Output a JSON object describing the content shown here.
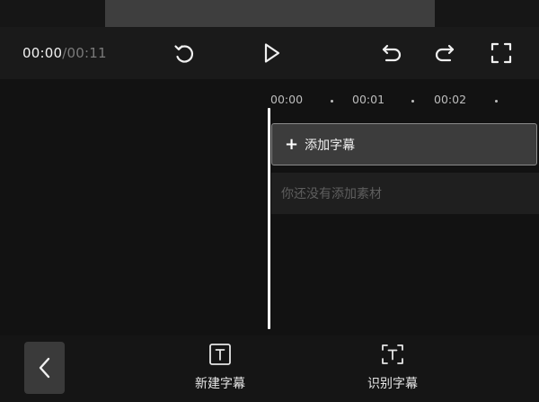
{
  "player": {
    "current_time": "00:00",
    "separator_total": "/00:11"
  },
  "timeline": {
    "ruler": [
      "00:00",
      "00:01",
      "00:02"
    ],
    "add_caption_label": "添加字幕",
    "empty_track_text": "你还没有添加素材"
  },
  "toolbar": {
    "new_caption_label": "新建字幕",
    "recognize_caption_label": "识别字幕"
  },
  "icons": {
    "reset": "rotate-ccw-icon",
    "play": "play-icon",
    "undo": "undo-icon",
    "redo": "redo-icon",
    "fullscreen": "fullscreen-icon",
    "back": "chevron-left-icon",
    "new_caption": "text-box-icon",
    "recognize_caption": "text-scan-icon"
  },
  "colors": {
    "background": "#161616",
    "track_highlight": "#3c3c3c",
    "playhead": "#ffffff"
  }
}
